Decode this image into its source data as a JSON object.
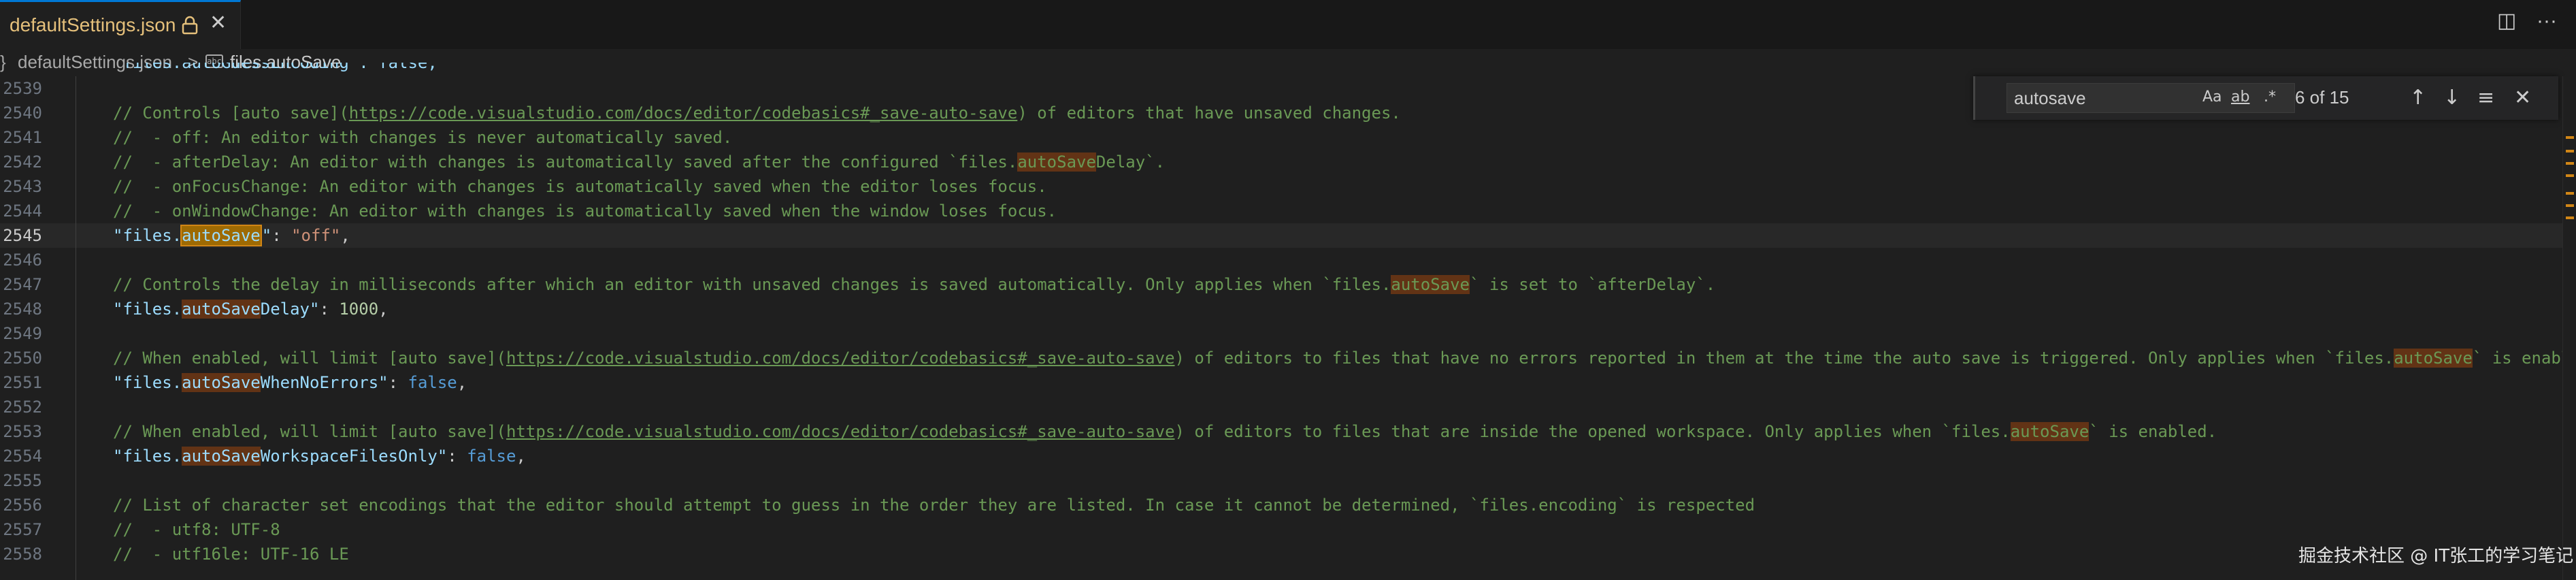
{
  "tab": {
    "label": "defaultSettings.json",
    "close_glyph": "✕",
    "lock_icon": "lock-icon"
  },
  "top_actions": {
    "split": "◫",
    "more": "···"
  },
  "breadcrumb": {
    "file": "defaultSettings.json",
    "separator": ">",
    "icon_label": "abc",
    "symbol": "files.autoSave"
  },
  "editor": {
    "partial_top_line": "\"files.autoGuessEncoding\": false,",
    "lines": [
      {
        "num": "2539",
        "segments": []
      },
      {
        "num": "2540",
        "segments": [
          {
            "t": "// Controls [auto save](",
            "c": "c-comment"
          },
          {
            "t": "https://code.visualstudio.com/docs/editor/codebasics#_save-auto-save",
            "c": "c-comment c-link"
          },
          {
            "t": ") of editors that have unsaved changes.",
            "c": "c-comment"
          }
        ]
      },
      {
        "num": "2541",
        "segments": [
          {
            "t": "//  - off: An editor with changes is never automatically saved.",
            "c": "c-comment"
          }
        ]
      },
      {
        "num": "2542",
        "segments": [
          {
            "t": "//  - afterDelay: An editor with changes is automatically saved after the configured `files.",
            "c": "c-comment"
          },
          {
            "t": "autoSave",
            "c": "c-comment hl"
          },
          {
            "t": "Delay`.",
            "c": "c-comment"
          }
        ]
      },
      {
        "num": "2543",
        "segments": [
          {
            "t": "//  - onFocusChange: An editor with changes is automatically saved when the editor loses focus.",
            "c": "c-comment"
          }
        ]
      },
      {
        "num": "2544",
        "segments": [
          {
            "t": "//  - onWindowChange: An editor with changes is automatically saved when the window loses focus.",
            "c": "c-comment"
          }
        ]
      },
      {
        "num": "2545",
        "current": true,
        "segments": [
          {
            "t": "\"files.",
            "c": "c-key"
          },
          {
            "t": "autoSave",
            "c": "c-key hl-cur"
          },
          {
            "t": "CURSOR",
            "c": "cursor"
          },
          {
            "t": "\"",
            "c": "c-key"
          },
          {
            "t": ": ",
            "c": "c-punc"
          },
          {
            "t": "\"off\"",
            "c": "c-string"
          },
          {
            "t": ",",
            "c": "c-punc"
          }
        ]
      },
      {
        "num": "2546",
        "segments": []
      },
      {
        "num": "2547",
        "segments": [
          {
            "t": "// Controls the delay in milliseconds after which an editor with unsaved changes is saved automatically. Only applies when `files.",
            "c": "c-comment"
          },
          {
            "t": "autoSave",
            "c": "c-comment hl"
          },
          {
            "t": "` is set to `afterDelay`.",
            "c": "c-comment"
          }
        ]
      },
      {
        "num": "2548",
        "segments": [
          {
            "t": "\"files.",
            "c": "c-key"
          },
          {
            "t": "autoSave",
            "c": "c-key hl"
          },
          {
            "t": "Delay\"",
            "c": "c-key"
          },
          {
            "t": ": ",
            "c": "c-punc"
          },
          {
            "t": "1000",
            "c": "c-num"
          },
          {
            "t": ",",
            "c": "c-punc"
          }
        ]
      },
      {
        "num": "2549",
        "segments": []
      },
      {
        "num": "2550",
        "segments": [
          {
            "t": "// When enabled, will limit [auto save](",
            "c": "c-comment"
          },
          {
            "t": "https://code.visualstudio.com/docs/editor/codebasics#_save-auto-save",
            "c": "c-comment c-link"
          },
          {
            "t": ") of editors to files that have no errors reported in them at the time the auto save is triggered. Only applies when `files.",
            "c": "c-comment"
          },
          {
            "t": "autoSave",
            "c": "c-comment hl"
          },
          {
            "t": "` is enabled.",
            "c": "c-comment"
          }
        ]
      },
      {
        "num": "2551",
        "segments": [
          {
            "t": "\"files.",
            "c": "c-key"
          },
          {
            "t": "autoSave",
            "c": "c-key hl"
          },
          {
            "t": "WhenNoErrors\"",
            "c": "c-key"
          },
          {
            "t": ": ",
            "c": "c-punc"
          },
          {
            "t": "false",
            "c": "c-bool"
          },
          {
            "t": ",",
            "c": "c-punc"
          }
        ]
      },
      {
        "num": "2552",
        "segments": []
      },
      {
        "num": "2553",
        "segments": [
          {
            "t": "// When enabled, will limit [auto save](",
            "c": "c-comment"
          },
          {
            "t": "https://code.visualstudio.com/docs/editor/codebasics#_save-auto-save",
            "c": "c-comment c-link"
          },
          {
            "t": ") of editors to files that are inside the opened workspace. Only applies when `files.",
            "c": "c-comment"
          },
          {
            "t": "autoSave",
            "c": "c-comment hl"
          },
          {
            "t": "` is enabled.",
            "c": "c-comment"
          }
        ]
      },
      {
        "num": "2554",
        "segments": [
          {
            "t": "\"files.",
            "c": "c-key"
          },
          {
            "t": "autoSave",
            "c": "c-key hl"
          },
          {
            "t": "WorkspaceFilesOnly\"",
            "c": "c-key"
          },
          {
            "t": ": ",
            "c": "c-punc"
          },
          {
            "t": "false",
            "c": "c-bool"
          },
          {
            "t": ",",
            "c": "c-punc"
          }
        ]
      },
      {
        "num": "2555",
        "segments": []
      },
      {
        "num": "2556",
        "segments": [
          {
            "t": "// List of character set encodings that the editor should attempt to guess in the order they are listed. In case it cannot be determined, `files.encoding` is respected",
            "c": "c-comment"
          }
        ]
      },
      {
        "num": "2557",
        "segments": [
          {
            "t": "//  - utf8: UTF-8",
            "c": "c-comment"
          }
        ]
      },
      {
        "num": "2558",
        "segments": [
          {
            "t": "//  - utf16le: UTF-16 LE",
            "c": "c-comment"
          }
        ]
      }
    ]
  },
  "find": {
    "query": "autosave",
    "match_case": "Aa",
    "whole_word": "ab",
    "regex": ".*",
    "count": "6 of 15",
    "prev": "↑",
    "next": "↓",
    "in_selection": "≡",
    "close": "✕"
  },
  "watermark": "掘金技术社区 @ IT张工的学习笔记",
  "colors": {
    "accent": "#0078d4",
    "match_highlight": "#623315",
    "current_match": "#9e6a03"
  }
}
